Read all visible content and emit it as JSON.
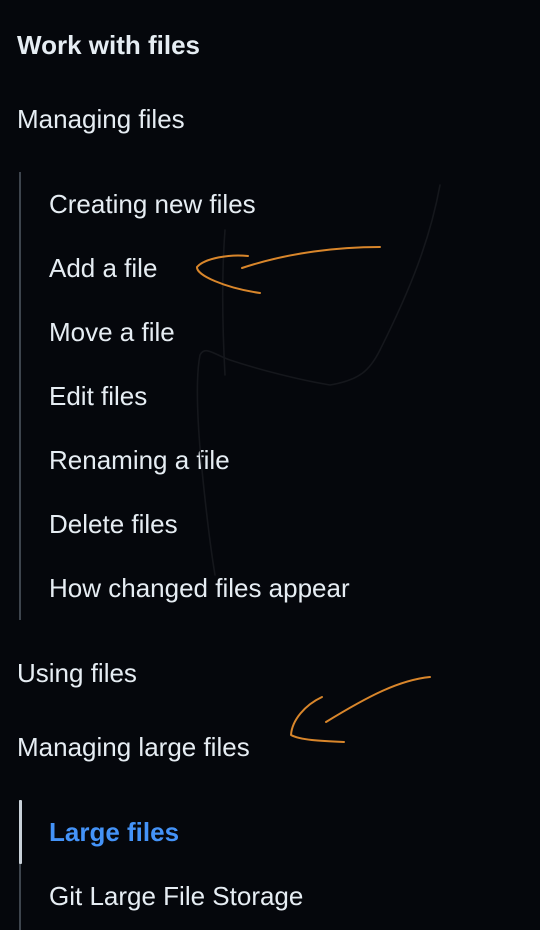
{
  "nav": {
    "section_title": "Work with files",
    "groups": [
      {
        "label": "Managing files",
        "items": [
          {
            "label": "Creating new files"
          },
          {
            "label": "Add a file"
          },
          {
            "label": "Move a file"
          },
          {
            "label": "Edit files"
          },
          {
            "label": "Renaming a file"
          },
          {
            "label": "Delete files"
          },
          {
            "label": "How changed files appear"
          }
        ]
      },
      {
        "label": "Using files"
      },
      {
        "label": "Managing large files",
        "items": [
          {
            "label": "Large files",
            "active": true
          },
          {
            "label": "Git Large File Storage"
          }
        ]
      }
    ]
  },
  "colors": {
    "background": "#05070c",
    "text": "#e6edf3",
    "active_link": "#4493f8",
    "tree_line": "#3d444d",
    "annotation_orange": "#d9862b"
  }
}
